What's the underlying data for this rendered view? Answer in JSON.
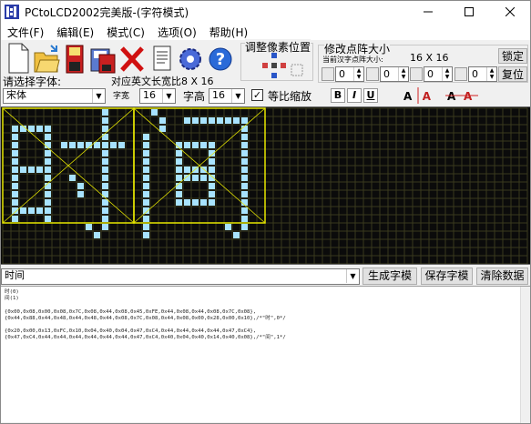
{
  "window": {
    "title": "PCtoLCD2002完美版-(字符模式)"
  },
  "menu": [
    "文件(F)",
    "编辑(E)",
    "模式(C)",
    "选项(O)",
    "帮助(H)"
  ],
  "toolbar": {
    "tools": [
      "new-file-icon",
      "open-folder-icon",
      "save-icon",
      "save-as-icon",
      "delete-icon",
      "document-icon",
      "gear-icon",
      "help-icon"
    ],
    "adjust_title": "调整像素位置",
    "resize_title": "修改点阵大小",
    "current_size_label": "当前汉字点阵大小:",
    "current_size": "16 X 16",
    "lock_label": "锁定",
    "restore_label": "复位",
    "spin_width": "0",
    "spin_height": "0",
    "spin_3": "0",
    "spin_4": "0",
    "font_select_label": "请选择字体:",
    "char_width_label": "对应英文长宽比8 X 16"
  },
  "font_row": {
    "font_name": "宋体",
    "width_label": "字宽",
    "width_value": "16",
    "height_label": "字高",
    "height_value": "16",
    "proportional_label": "等比缩放",
    "proportional_checked": true,
    "bold": "B",
    "italic": "I",
    "underline": "U"
  },
  "input": {
    "text": "时间"
  },
  "buttons": {
    "generate": "生成字模",
    "save": "保存字模",
    "clear": "清除数据"
  },
  "output_lines": [
    "时(0)",
    "间(1)",
    "",
    "{0x00,0x08,0x00,0x08,0x7C,0x08,0x44,0x08,0x45,0xFE,0x44,0x08,0x44,0x08,0x7C,0x08},",
    "{0x44,0x88,0x44,0x48,0x44,0x48,0x44,0x08,0x7C,0x08,0x44,0x08,0x00,0x28,0x00,0x10},/*\"时\",0*/",
    "",
    "{0x20,0x00,0x13,0xFC,0x10,0x04,0x40,0x04,0x47,0xC4,0x44,0x44,0x44,0x44,0x47,0xC4},",
    "{0x47,0xC4,0x44,0x44,0x44,0x44,0x44,0x44,0x47,0xC4,0x40,0x04,0x40,0x14,0x40,0x08},/*\"间\",1*/"
  ],
  "glyphs": {
    "colors": {
      "pixel": "#a8e3ff",
      "grid": "#3a3a1e",
      "frame": "#e6e600",
      "background": "#0b0b0b"
    },
    "cols": 64,
    "rows": 19,
    "bitmaps": [
      [
        "0000000000001000",
        "0000000000001000",
        "0111110000001000",
        "0100010000001000",
        "0100010111111110",
        "0100010000001000",
        "0100010000001000",
        "0111110000001000",
        "0100010010001000",
        "0100010001001000",
        "0100010001001000",
        "0100010000001000",
        "0111110000001000",
        "0100010000001000",
        "0000000000101000",
        "0000000000010000"
      ],
      [
        "0010000000000000",
        "0001001111111100",
        "0001000000000100",
        "0100000000000100",
        "0100011111000100",
        "0100010001000100",
        "0100010001000100",
        "0100011111000100",
        "0100011111000100",
        "0100010001000100",
        "0100010001000100",
        "0100011111000100",
        "0100000000000100",
        "0100000000000100",
        "0100000000010100",
        "0100000000001000"
      ]
    ]
  }
}
